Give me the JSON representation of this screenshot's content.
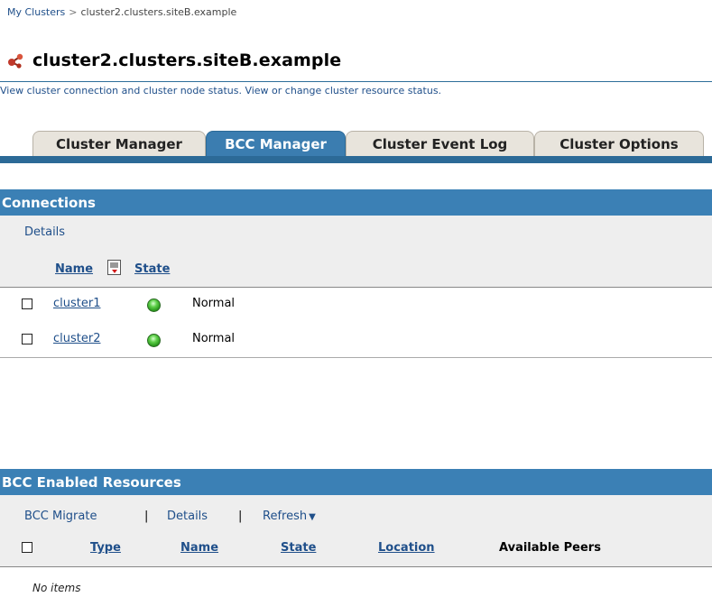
{
  "breadcrumb": {
    "root_label": "My Clusters",
    "separator": ">",
    "current": "cluster2.clusters.siteB.example"
  },
  "page": {
    "title": "cluster2.clusters.siteB.example",
    "description": "View cluster connection and cluster node status. View or change cluster resource status."
  },
  "tabs": [
    {
      "label": "Cluster Manager",
      "active": false
    },
    {
      "label": "BCC Manager",
      "active": true
    },
    {
      "label": "Cluster Event Log",
      "active": false
    },
    {
      "label": "Cluster Options",
      "active": false
    }
  ],
  "connections": {
    "header": "Connections",
    "details_label": "Details",
    "columns": {
      "name": "Name",
      "state": "State"
    },
    "rows": [
      {
        "name": "cluster1",
        "state": "Normal",
        "status_color": "#3cb82a"
      },
      {
        "name": "cluster2",
        "state": "Normal",
        "status_color": "#3cb82a"
      }
    ]
  },
  "resources": {
    "header": "BCC Enabled Resources",
    "actions": {
      "migrate": "BCC Migrate",
      "details": "Details",
      "refresh": "Refresh",
      "separator": "|"
    },
    "columns": {
      "type": "Type",
      "name": "Name",
      "state": "State",
      "location": "Location",
      "peers": "Available Peers"
    },
    "empty_text": "No items"
  },
  "colors": {
    "accent": "#3b80b5",
    "link": "#1f4f8a",
    "tab_inactive": "#e8e4dc"
  }
}
